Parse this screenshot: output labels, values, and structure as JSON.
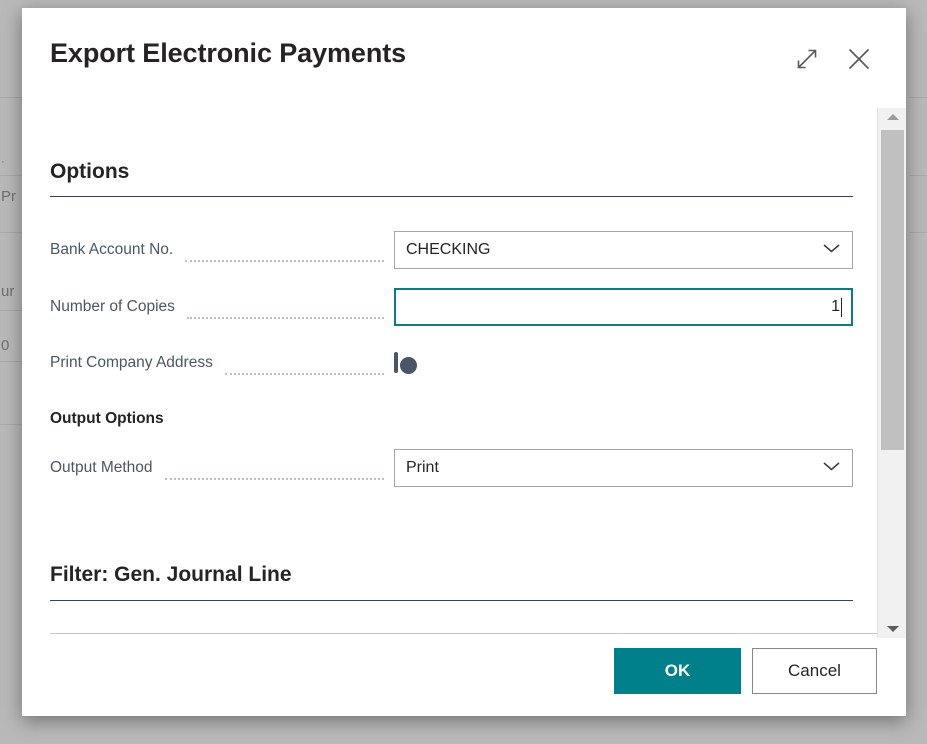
{
  "background": {
    "fragments": [
      "·",
      "Pr",
      "ur",
      "0"
    ]
  },
  "dialog": {
    "title": "Export Electronic Payments",
    "expand_icon": "expand-diagonal-icon",
    "close_icon": "close-x-icon",
    "options_section": {
      "heading": "Options",
      "fields": [
        {
          "label": "Bank Account No.",
          "type": "dropdown",
          "value": "CHECKING",
          "icon": "chevron-down-icon"
        },
        {
          "label": "Number of Copies",
          "type": "text",
          "value": "1",
          "focused": true
        },
        {
          "label": "Print Company Address",
          "type": "toggle",
          "value": "off"
        }
      ],
      "sub_heading": "Output Options",
      "output_fields": [
        {
          "label": "Output Method",
          "type": "dropdown",
          "value": "Print",
          "icon": "chevron-down-icon"
        }
      ]
    },
    "filter_section": {
      "heading": "Filter: Gen. Journal Line"
    },
    "footer": {
      "ok_label": "OK",
      "cancel_label": "Cancel"
    },
    "scrollbar": {
      "up_icon": "triangle-up-icon",
      "down_icon": "triangle-down-icon"
    }
  },
  "colors": {
    "accent_teal": "#00808a",
    "focus_teal": "#0c7b85",
    "label_slate": "#4b5767",
    "heading_dark": "#252423",
    "rule_dark": "#3b4256"
  }
}
